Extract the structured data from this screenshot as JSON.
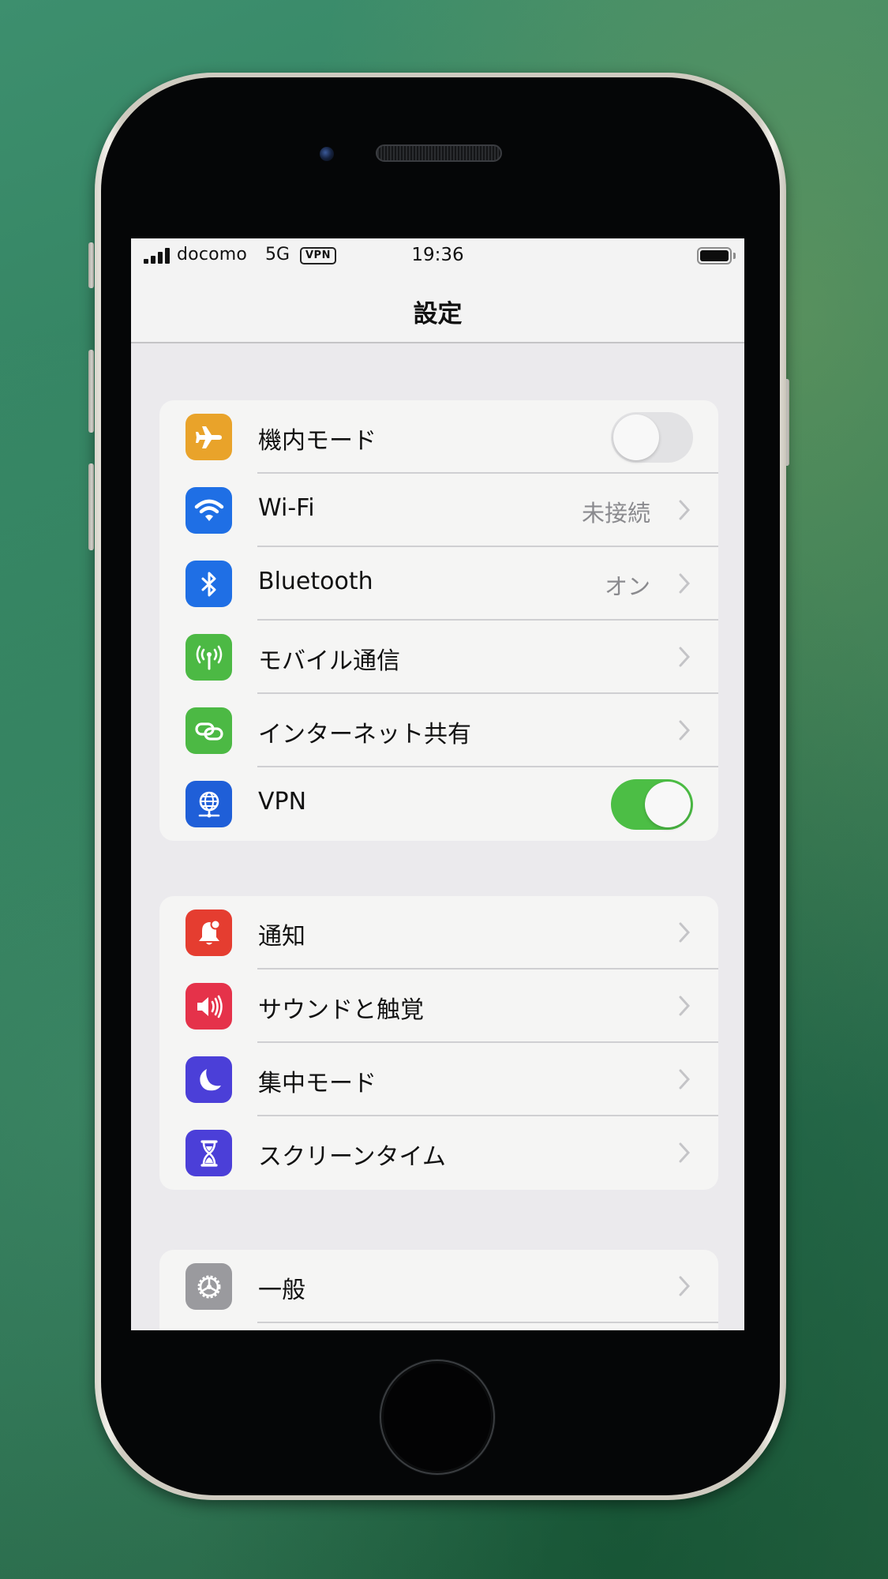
{
  "device": {
    "hardware": [
      "front-camera",
      "earpiece-speaker",
      "home-button",
      "mute-switch",
      "volume-up-button",
      "volume-down-button",
      "side-button"
    ]
  },
  "status_bar": {
    "signal_bars": 4,
    "carrier": "docomo",
    "network": "5G",
    "vpn_badge": "VPN",
    "time": "19:36",
    "battery_icon": "battery-icon"
  },
  "nav": {
    "title": "設定"
  },
  "colors": {
    "airplane": "#E9A32A",
    "wifi": "#1F6FE5",
    "bluetooth": "#1F6FE5",
    "cellular": "#4CB944",
    "hotspot": "#4CB944",
    "vpn": "#1F5FD8",
    "notifications": "#E53D30",
    "sounds": "#E5324A",
    "focus": "#4B3FD8",
    "screen_time": "#4B3FD8",
    "general": "#9A9A9E",
    "toggle_on": "#4CBE45",
    "toggle_off": "#E2E2E4"
  },
  "groups": [
    {
      "items": [
        {
          "id": "airplane",
          "icon": "airplane-icon",
          "label": "機内モード",
          "control": "toggle",
          "on": false
        },
        {
          "id": "wifi",
          "icon": "wifi-icon",
          "label": "Wi-Fi",
          "value": "未接続",
          "control": "chevron"
        },
        {
          "id": "bluetooth",
          "icon": "bluetooth-icon",
          "label": "Bluetooth",
          "value": "オン",
          "control": "chevron"
        },
        {
          "id": "cellular",
          "icon": "antenna-icon",
          "label": "モバイル通信",
          "control": "chevron"
        },
        {
          "id": "hotspot",
          "icon": "link-chain-icon",
          "label": "インターネット共有",
          "control": "chevron"
        },
        {
          "id": "vpn",
          "icon": "globe-network-icon",
          "label": "VPN",
          "control": "toggle",
          "on": true
        }
      ]
    },
    {
      "items": [
        {
          "id": "notifications",
          "icon": "bell-icon",
          "label": "通知",
          "control": "chevron"
        },
        {
          "id": "sounds",
          "icon": "speaker-icon",
          "label": "サウンドと触覚",
          "control": "chevron"
        },
        {
          "id": "focus",
          "icon": "moon-icon",
          "label": "集中モード",
          "control": "chevron"
        },
        {
          "id": "screen_time",
          "icon": "hourglass-icon",
          "label": "スクリーンタイム",
          "control": "chevron"
        }
      ]
    },
    {
      "items": [
        {
          "id": "general",
          "icon": "gear-icon",
          "label": "一般",
          "control": "chevron"
        }
      ]
    }
  ]
}
